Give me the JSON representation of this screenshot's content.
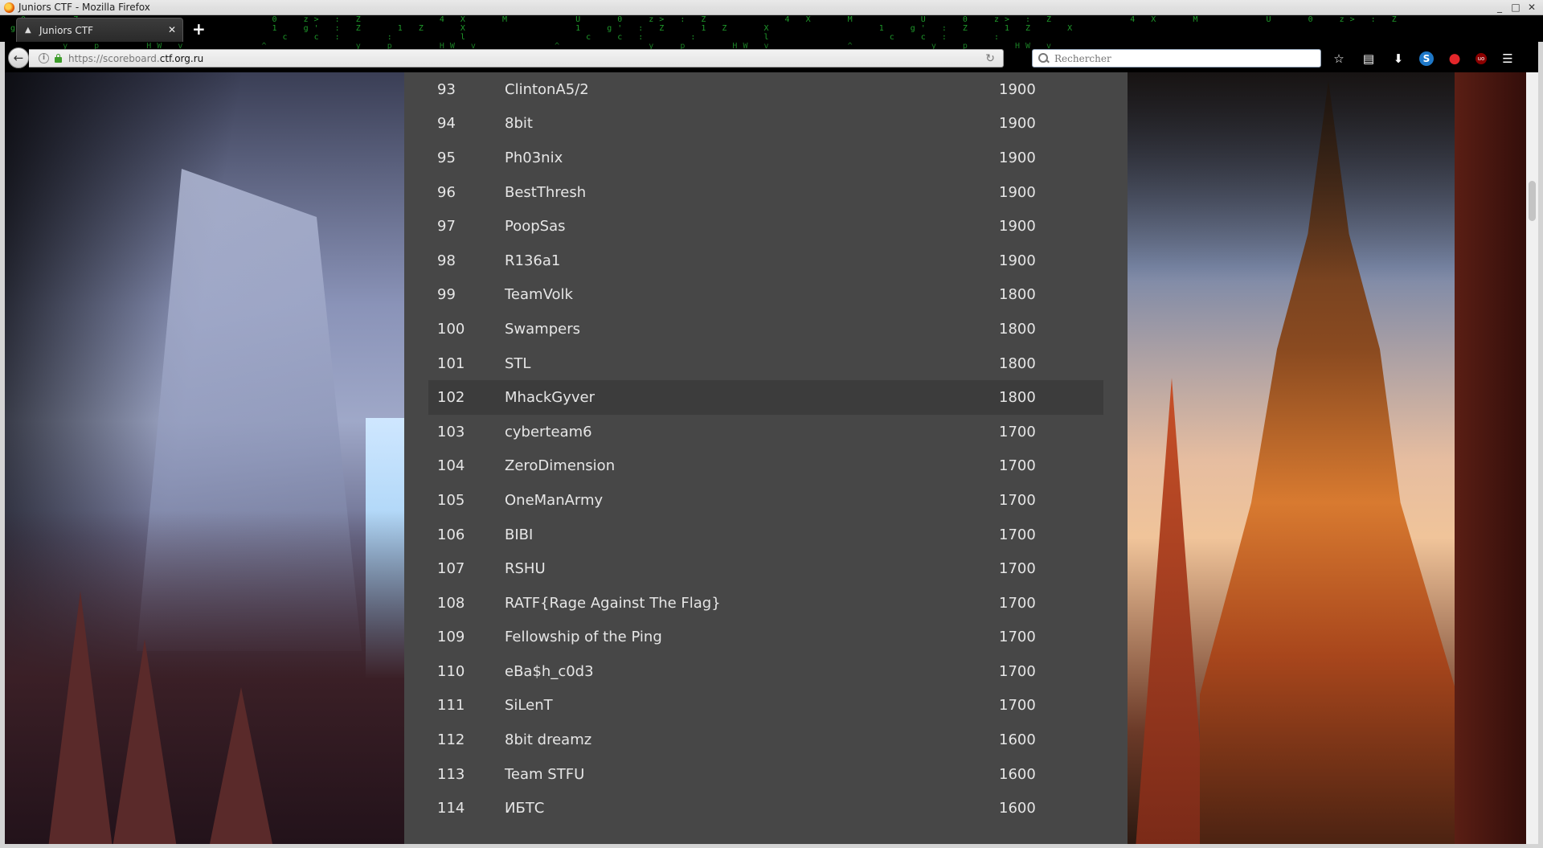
{
  "window": {
    "title": "Juniors CTF - Mozilla Firefox",
    "controls": [
      "_",
      "□",
      "✕"
    ]
  },
  "tabs": [
    {
      "label": "Juniors CTF",
      "active": true,
      "close": "✕"
    }
  ],
  "new_tab": "+",
  "navbar": {
    "back": "←",
    "url_prefix": "https://scoreboard.",
    "url_host": "ctf.org.ru",
    "reload": "↻",
    "search_placeholder": "Rechercher"
  },
  "toolbar": {
    "icons": [
      "star-icon",
      "reading-list-icon",
      "download-icon",
      "skype-icon",
      "addon-icon",
      "ublock-icon",
      "menu-icon"
    ],
    "glyphs": {
      "star": "☆",
      "reading_list": "▤",
      "download": "⬇",
      "skype": "S",
      "addon": "●",
      "ublock": "uo",
      "menu": "☰"
    }
  },
  "scoreboard": {
    "rows": [
      {
        "rank": "93",
        "team": "ClintonA5/2",
        "score": "1900"
      },
      {
        "rank": "94",
        "team": "8bit",
        "score": "1900"
      },
      {
        "rank": "95",
        "team": "Ph03nix",
        "score": "1900"
      },
      {
        "rank": "96",
        "team": "BestThresh",
        "score": "1900"
      },
      {
        "rank": "97",
        "team": "PoopSas",
        "score": "1900"
      },
      {
        "rank": "98",
        "team": "R136a1",
        "score": "1900"
      },
      {
        "rank": "99",
        "team": "TeamVolk",
        "score": "1800"
      },
      {
        "rank": "100",
        "team": "Swampers",
        "score": "1800"
      },
      {
        "rank": "101",
        "team": "STL",
        "score": "1800"
      },
      {
        "rank": "102",
        "team": "MhackGyver",
        "score": "1800",
        "highlighted": true
      },
      {
        "rank": "103",
        "team": "cyberteam6",
        "score": "1700"
      },
      {
        "rank": "104",
        "team": "ZeroDimension",
        "score": "1700"
      },
      {
        "rank": "105",
        "team": "OneManArmy",
        "score": "1700"
      },
      {
        "rank": "106",
        "team": "BIBI",
        "score": "1700"
      },
      {
        "rank": "107",
        "team": "RSHU",
        "score": "1700"
      },
      {
        "rank": "108",
        "team": "RATF{Rage Against The Flag}",
        "score": "1700"
      },
      {
        "rank": "109",
        "team": "Fellowship of the Ping",
        "score": "1700"
      },
      {
        "rank": "110",
        "team": "eBa$h_c0d3",
        "score": "1700"
      },
      {
        "rank": "111",
        "team": "SiLenT",
        "score": "1700"
      },
      {
        "rank": "112",
        "team": "8bit dreamz",
        "score": "1600"
      },
      {
        "rank": "113",
        "team": "Team STFU",
        "score": "1600"
      },
      {
        "rank": "114",
        "team": "ИБТС",
        "score": "1600"
      }
    ]
  },
  "colors": {
    "panel_bg": "#474747",
    "highlight_row": "#3c3c3c",
    "text": "#e6e6e6",
    "matrix_green": "#1f9a2b"
  }
}
